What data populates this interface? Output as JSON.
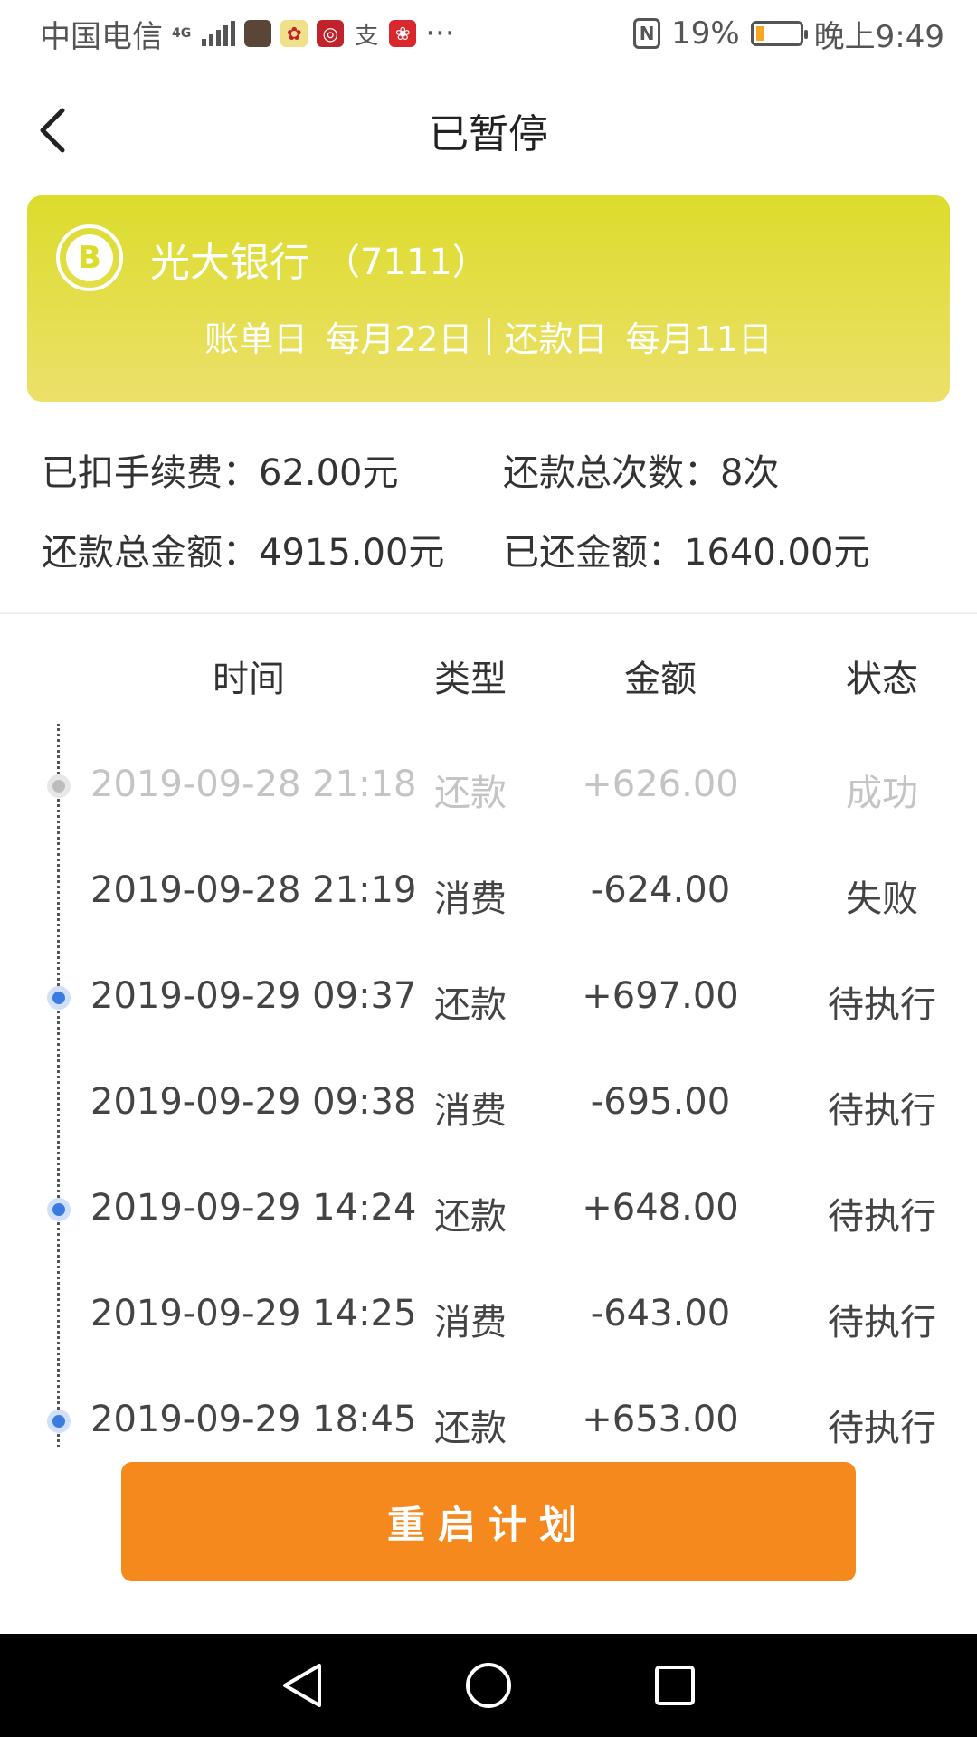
{
  "status_bar": {
    "carrier": "中国电信",
    "network": "4G",
    "battery": "19%",
    "time": "晚上9:49",
    "more": "···"
  },
  "header": {
    "title": "已暂停"
  },
  "card": {
    "bank_name": "光大银行",
    "card_suffix": "（7111）",
    "bill_day_label": "账单日",
    "bill_day_value": "每月22日",
    "repay_day_label": "还款日",
    "repay_day_value": "每月11日",
    "colors": {
      "gradient_top": "#dcdc2c",
      "gradient_bottom": "#ece06a"
    }
  },
  "stats": {
    "fee": "已扣手续费：62.00元",
    "count": "还款总次数：8次",
    "total": "还款总金额：4915.00元",
    "repaid": "已还金额：1640.00元"
  },
  "table": {
    "headers": [
      "时间",
      "类型",
      "金额",
      "状态"
    ],
    "rows": [
      {
        "time": "2019-09-28 21:18",
        "type": "还款",
        "amount": "+626.00",
        "status": "成功"
      },
      {
        "time": "2019-09-28 21:19",
        "type": "消费",
        "amount": "-624.00",
        "status": "失败"
      },
      {
        "time": "2019-09-29 09:37",
        "type": "还款",
        "amount": "+697.00",
        "status": "待执行"
      },
      {
        "time": "2019-09-29 09:38",
        "type": "消费",
        "amount": "-695.00",
        "status": "待执行"
      },
      {
        "time": "2019-09-29 14:24",
        "type": "还款",
        "amount": "+648.00",
        "status": "待执行"
      },
      {
        "time": "2019-09-29 14:25",
        "type": "消费",
        "amount": "-643.00",
        "status": "待执行"
      },
      {
        "time": "2019-09-29 18:45",
        "type": "还款",
        "amount": "+653.00",
        "status": "待执行"
      }
    ]
  },
  "actions": {
    "restart_label": "重启计划",
    "accent": "#f5891d"
  },
  "icons": {
    "back": "chevron-left-icon",
    "nav_back": "triangle-back-icon",
    "nav_home": "circle-home-icon",
    "nav_recent": "square-recent-icon"
  }
}
